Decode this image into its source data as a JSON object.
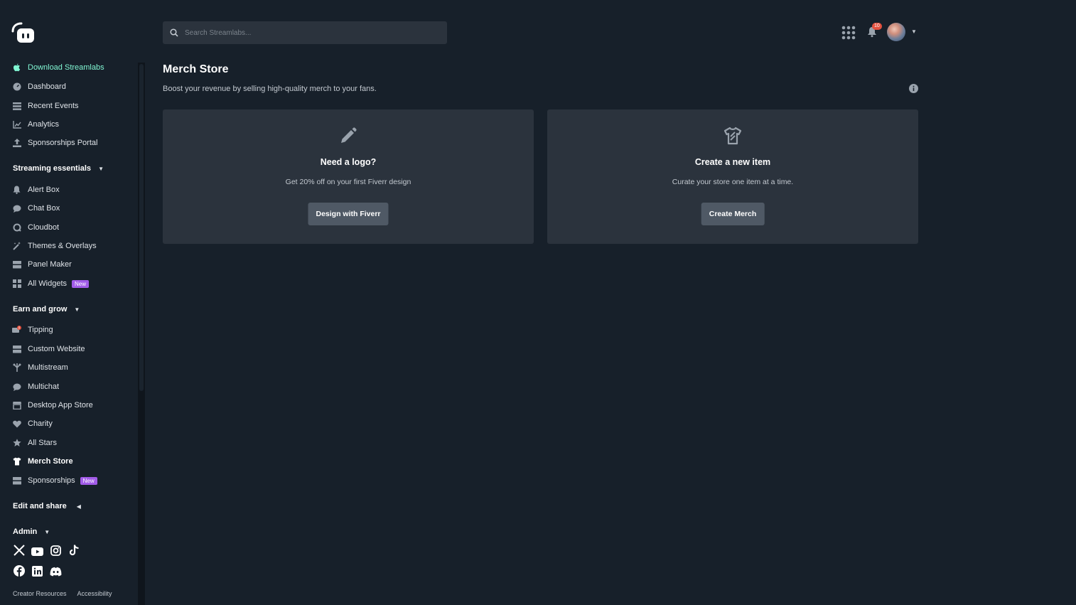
{
  "search": {
    "placeholder": "Search Streamlabs..."
  },
  "topbar": {
    "notification_count": "10"
  },
  "sidebar": {
    "download": "Download Streamlabs",
    "main_items": [
      {
        "label": "Dashboard",
        "icon": "dashboard-icon"
      },
      {
        "label": "Recent Events",
        "icon": "list-icon"
      },
      {
        "label": "Analytics",
        "icon": "chart-icon"
      },
      {
        "label": "Sponsorships Portal",
        "icon": "upload-icon"
      }
    ],
    "streaming_essentials": {
      "title": "Streaming essentials",
      "items": [
        {
          "label": "Alert Box",
          "icon": "bell-icon"
        },
        {
          "label": "Chat Box",
          "icon": "chat-bubble-icon"
        },
        {
          "label": "Cloudbot",
          "icon": "cloudbot-icon"
        },
        {
          "label": "Themes & Overlays",
          "icon": "magic-wand-icon"
        },
        {
          "label": "Panel Maker",
          "icon": "panel-icon"
        },
        {
          "label": "All Widgets",
          "icon": "widgets-icon",
          "badge": "New"
        }
      ]
    },
    "earn_and_grow": {
      "title": "Earn and grow",
      "items": [
        {
          "label": "Tipping",
          "icon": "tipping-icon"
        },
        {
          "label": "Custom Website",
          "icon": "website-icon"
        },
        {
          "label": "Multistream",
          "icon": "multistream-icon"
        },
        {
          "label": "Multichat",
          "icon": "multichat-icon"
        },
        {
          "label": "Desktop App Store",
          "icon": "store-icon"
        },
        {
          "label": "Charity",
          "icon": "heart-icon"
        },
        {
          "label": "All Stars",
          "icon": "star-icon"
        },
        {
          "label": "Merch Store",
          "icon": "shirt-icon"
        },
        {
          "label": "Sponsorships",
          "icon": "sponsorships-icon",
          "badge": "New"
        }
      ]
    },
    "edit_and_share": {
      "title": "Edit and share"
    },
    "admin": {
      "title": "Admin"
    },
    "socials": [
      "x-icon",
      "youtube-icon",
      "instagram-icon",
      "tiktok-icon",
      "facebook-icon",
      "linkedin-icon",
      "discord-icon"
    ],
    "footer": {
      "creator_resources": "Creator Resources",
      "accessibility": "Accessibility"
    }
  },
  "main": {
    "title": "Merch Store",
    "subtitle": "Boost your revenue by selling high-quality merch to your fans.",
    "cards": [
      {
        "icon": "pencil-icon",
        "title": "Need a logo?",
        "desc": "Get 20% off on your first Fiverr design",
        "button": "Design with Fiverr"
      },
      {
        "icon": "tshirt-icon",
        "title": "Create a new item",
        "desc": "Curate your store one item at a time.",
        "button": "Create Merch"
      }
    ]
  },
  "colors": {
    "accent": "#80f5d2",
    "background": "#17202a",
    "card": "#2b333d",
    "badge_new": "#a25ce8",
    "notification": "#e3513f"
  }
}
